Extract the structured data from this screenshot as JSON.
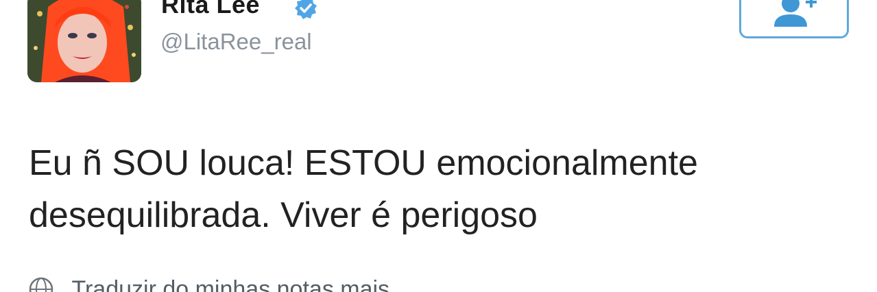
{
  "user": {
    "display_name": "Rita Lee",
    "handle": "@LitaRee_real",
    "verified": true,
    "avatar_icon": "profile-photo"
  },
  "follow_button": {
    "icon": "add-user-icon",
    "color": "#5ea8dd"
  },
  "tweet": {
    "lines": [
      "Eu ñ SOU louca! ESTOU emocionalmente",
      "desequilibrada. Viver é perigoso"
    ]
  },
  "translate": {
    "icon": "globe-icon",
    "label": "Traduzir do minhas notas mais"
  },
  "colors": {
    "accent": "#5ea8dd",
    "handle": "#8a939c",
    "text": "#222222"
  }
}
